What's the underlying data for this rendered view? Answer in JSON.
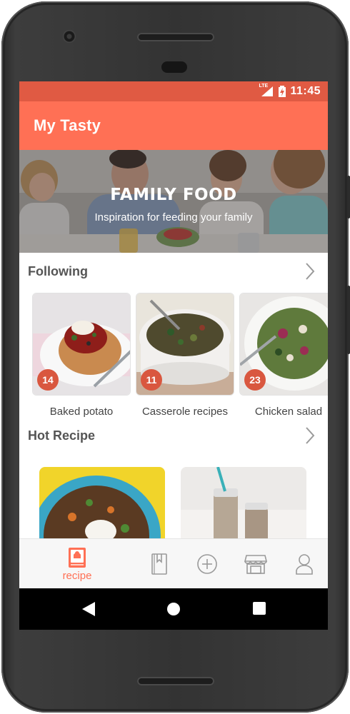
{
  "status_bar": {
    "network_label": "LTE",
    "time": "11:45"
  },
  "app_bar": {
    "title": "My Tasty"
  },
  "banner": {
    "title": "FAMILY FOOD",
    "subtitle": "Inspiration for feeding your family"
  },
  "following": {
    "title": "Following",
    "items": [
      {
        "label": "Baked potato",
        "count": "14"
      },
      {
        "label": "Casserole recipes",
        "count": "11"
      },
      {
        "label": "Chicken salad",
        "count": "23"
      }
    ]
  },
  "hot_recipe": {
    "title": "Hot Recipe"
  },
  "bottom_nav": {
    "items": [
      {
        "icon": "recipe-book-icon",
        "label": "recipe",
        "active": true
      },
      {
        "icon": "bookmark-icon"
      },
      {
        "icon": "plus-circle-icon"
      },
      {
        "icon": "store-icon"
      },
      {
        "icon": "profile-icon"
      }
    ]
  },
  "colors": {
    "accent": "#ff7055",
    "status_bar": "#e05a43",
    "badge": "#d9573f"
  }
}
